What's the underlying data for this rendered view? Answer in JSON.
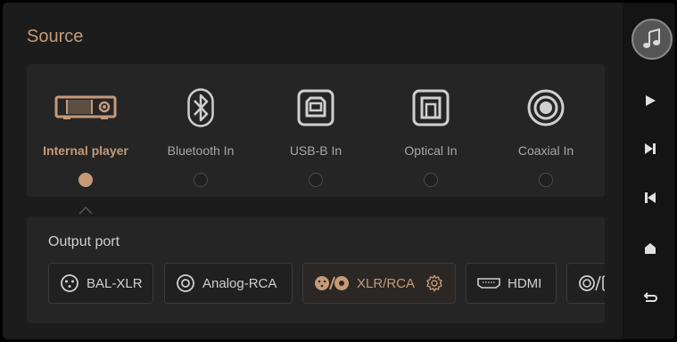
{
  "header": {
    "title": "Source"
  },
  "sources": [
    {
      "label": "Internal player",
      "icon": "player-device-icon",
      "selected": true
    },
    {
      "label": "Bluetooth In",
      "icon": "bluetooth-icon",
      "selected": false
    },
    {
      "label": "USB-B In",
      "icon": "usb-b-icon",
      "selected": false
    },
    {
      "label": "Optical In",
      "icon": "optical-icon",
      "selected": false
    },
    {
      "label": "Coaxial In",
      "icon": "coaxial-icon",
      "selected": false
    }
  ],
  "output": {
    "title": "Output port",
    "ports": [
      {
        "label": "BAL-XLR",
        "icon": "xlr-icon",
        "selected": false
      },
      {
        "label": "Analog-RCA",
        "icon": "rca-icon",
        "selected": false
      },
      {
        "label": "XLR/RCA",
        "icon": "xlr-rca-icon",
        "selected": true,
        "settings_icon": "gear-icon"
      },
      {
        "label": "HDMI",
        "icon": "hdmi-icon",
        "selected": false
      }
    ]
  },
  "sidebar": {
    "buttons": [
      "music-note-icon",
      "play-icon",
      "next-track-icon",
      "previous-track-icon",
      "home-icon",
      "back-icon"
    ]
  },
  "colors": {
    "accent": "#c59a78",
    "background": "#1c1c1c",
    "panel": "#252525",
    "sidebar": "#141414"
  }
}
